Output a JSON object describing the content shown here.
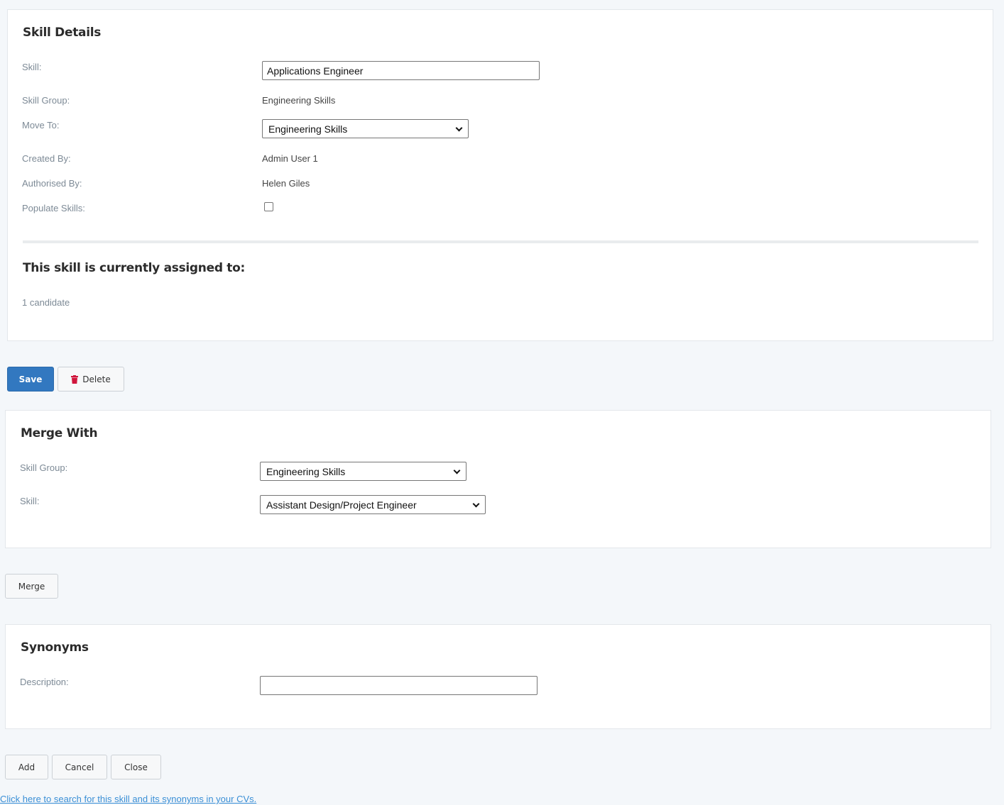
{
  "skill_details": {
    "title": "Skill Details",
    "skill_label": "Skill:",
    "skill_value": "Applications Engineer",
    "skill_group_label": "Skill Group:",
    "skill_group_value": "Engineering Skills",
    "move_to_label": "Move To:",
    "move_to_value": "Engineering Skills",
    "created_by_label": "Created By:",
    "created_by_value": "Admin User 1",
    "authorised_by_label": "Authorised By:",
    "authorised_by_value": "Helen Giles",
    "populate_skills_label": "Populate Skills:",
    "populate_skills_checked": false,
    "assigned_heading": "This skill is currently assigned to:",
    "assigned_count": "1 candidate"
  },
  "actions": {
    "save_label": "Save",
    "delete_label": "Delete"
  },
  "merge_with": {
    "title": "Merge With",
    "skill_group_label": "Skill Group:",
    "skill_group_value": "Engineering Skills",
    "skill_label": "Skill:",
    "skill_value": "Assistant Design/Project Engineer",
    "merge_label": "Merge"
  },
  "synonyms": {
    "title": "Synonyms",
    "description_label": "Description:",
    "description_value": "",
    "add_label": "Add",
    "cancel_label": "Cancel",
    "close_label": "Close"
  },
  "footer": {
    "search_link": "Click here to search for this skill and its synonyms in your CVs."
  },
  "colors": {
    "primary": "#3278c0",
    "delete_icon": "#d0163c",
    "link": "#3a8fd6",
    "background": "#f4f7fa"
  }
}
